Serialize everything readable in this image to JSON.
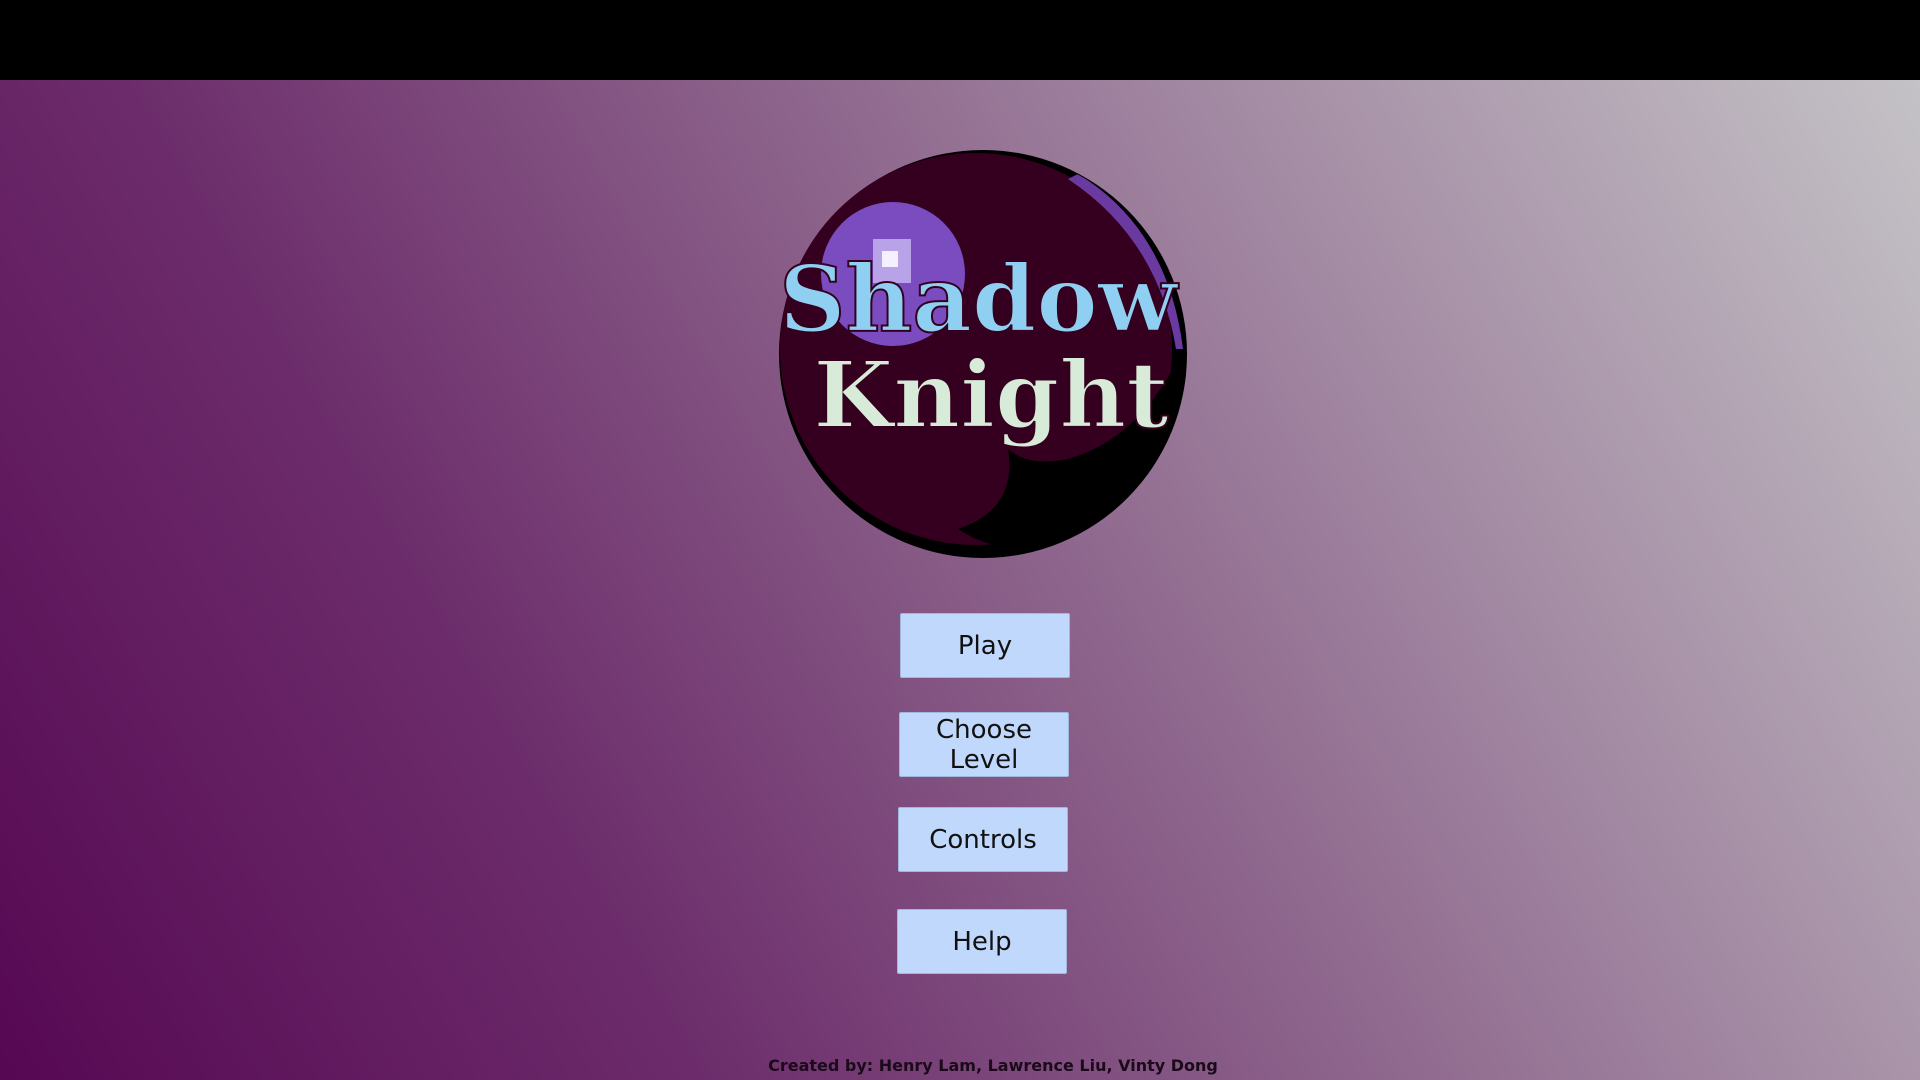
{
  "game": {
    "logo": {
      "title_line1": "Shadow",
      "title_line2": "Knight"
    },
    "menu": {
      "play_label": "Play",
      "choose_level_label": "Choose Level",
      "controls_label": "Controls",
      "help_label": "Help"
    },
    "credits": "Created by: Henry Lam, Lawrence Liu, Vinty Dong"
  },
  "colors": {
    "background_start": "#560852",
    "background_end": "#c4c2c6",
    "button_fill": "#c0d8fb",
    "logo_sphere": "#33001f",
    "title_blue": "#8fd0f2",
    "title_white": "#d8ead8"
  }
}
